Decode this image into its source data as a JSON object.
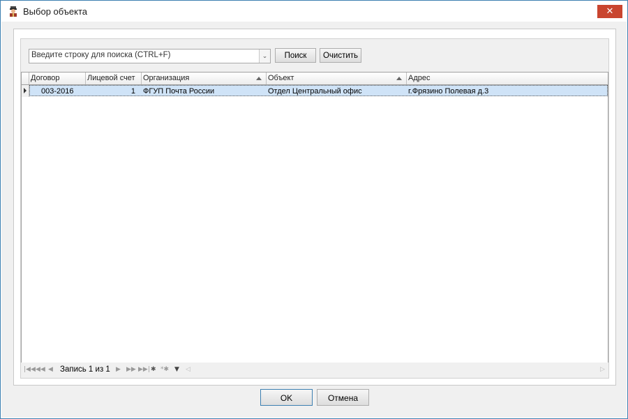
{
  "window": {
    "title": "Выбор объекта",
    "close_glyph": "✕"
  },
  "search": {
    "placeholder": "Введите строку для поиска (CTRL+F)",
    "dropdown_glyph": "⌄"
  },
  "toolbar": {
    "search_label": "Поиск",
    "clear_label": "Очистить"
  },
  "grid": {
    "columns": [
      {
        "label": "Договор",
        "sorted": false
      },
      {
        "label": "Лицевой счет",
        "sorted": false
      },
      {
        "label": "Организация",
        "sorted": true
      },
      {
        "label": "Объект",
        "sorted": true
      },
      {
        "label": "Адрес",
        "sorted": false
      }
    ],
    "rows": [
      {
        "contract": "003-2016",
        "account": "1",
        "organization": "ФГУП Почта России",
        "object": "Отдел Центральный офис",
        "address": "г.Фрязино Полевая д.3",
        "selected": true
      }
    ]
  },
  "navigator": {
    "record_label": "Запись 1 из 1",
    "icons": [
      "first-page-icon",
      "prev-page-icon",
      "prev-record-icon",
      "next-record-icon",
      "next-page-icon",
      "last-page-icon",
      "append-icon",
      "insert-icon",
      "filter-icon",
      "scroll-left-icon",
      "scroll-right-icon"
    ]
  },
  "footer": {
    "ok_label": "OK",
    "cancel_label": "Отмена"
  },
  "colors": {
    "accent_border": "#3c7fb1",
    "close_button": "#c9452f",
    "selected_row": "#cfe3f7"
  }
}
